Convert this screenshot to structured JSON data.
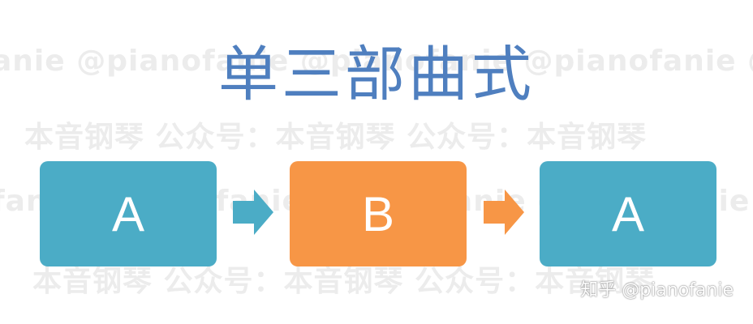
{
  "title": "单三部曲式",
  "watermark": {
    "rows": [
      "anie @pianofanie @pianofanie @pianofanie @pianofanie",
      "本音钢琴  公众号：本音钢琴  公众号：本音钢琴",
      "fanie @pianofanie @pianofanie @pianofanie @pi",
      "本音钢琴  公众号：本音钢琴  公众号：本音钢琴"
    ]
  },
  "sections": [
    {
      "label": "A",
      "color": "#4bacc6"
    },
    {
      "label": "B",
      "color": "#f79646"
    },
    {
      "label": "A",
      "color": "#4bacc6"
    }
  ],
  "arrows": [
    {
      "color": "#4bacc6"
    },
    {
      "color": "#f79646"
    }
  ],
  "credit": "知乎 @pianofanie"
}
